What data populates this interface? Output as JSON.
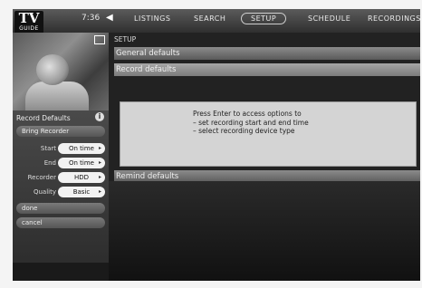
{
  "logo": {
    "top": "TV",
    "bottom": "GUIDE"
  },
  "top_bar": {
    "time": "7:36",
    "nav": [
      "LISTINGS",
      "SEARCH",
      "SETUP",
      "SCHEDULE",
      "RECORDINGS"
    ],
    "active_nav": "SETUP"
  },
  "left_panel": {
    "title": "Record Defaults",
    "header_pill": "Bring Recorder",
    "rows": [
      {
        "label": "Start",
        "value": "On time"
      },
      {
        "label": "End",
        "value": "On time"
      },
      {
        "label": "Recorder",
        "value": "HDD"
      },
      {
        "label": "Quality",
        "value": "Basic"
      }
    ],
    "done_label": "done",
    "cancel_label": "cancel"
  },
  "main": {
    "breadcrumb": "SETUP",
    "sections": [
      "General defaults",
      "Record defaults",
      "Remind defaults"
    ],
    "info_text": "Press Enter to access options to\n– set recording start and end time\n– select recording device type"
  }
}
